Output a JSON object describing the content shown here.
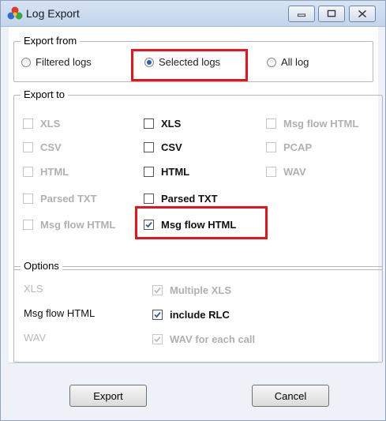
{
  "window": {
    "title": "Log Export",
    "icon": "app-logo-icon"
  },
  "export_from": {
    "legend": "Export from",
    "options": [
      {
        "label": "Filtered logs",
        "selected": false
      },
      {
        "label": "Selected logs",
        "selected": true
      },
      {
        "label": "All log",
        "selected": false
      }
    ]
  },
  "export_to": {
    "legend": "Export to",
    "col1": [
      "XLS",
      "CSV",
      "HTML",
      "Parsed TXT",
      "Msg flow HTML"
    ],
    "col2": [
      "XLS",
      "CSV",
      "HTML",
      "Parsed TXT",
      "Msg flow HTML"
    ],
    "col3": [
      "Msg flow HTML",
      "PCAP",
      "WAV"
    ],
    "col2_checked": [
      false,
      false,
      false,
      false,
      true
    ]
  },
  "options": {
    "legend": "Options",
    "rows": [
      {
        "label": "XLS",
        "check_label": "Multiple XLS",
        "checked": true,
        "enabled": false
      },
      {
        "label": "Msg flow HTML",
        "check_label": "include RLC",
        "checked": true,
        "enabled": true
      },
      {
        "label": "WAV",
        "check_label": "WAV for each call",
        "checked": true,
        "enabled": false
      }
    ]
  },
  "buttons": {
    "export": "Export",
    "cancel": "Cancel"
  },
  "colors": {
    "highlight": "#e8141b",
    "check": "#2a5fb0"
  }
}
